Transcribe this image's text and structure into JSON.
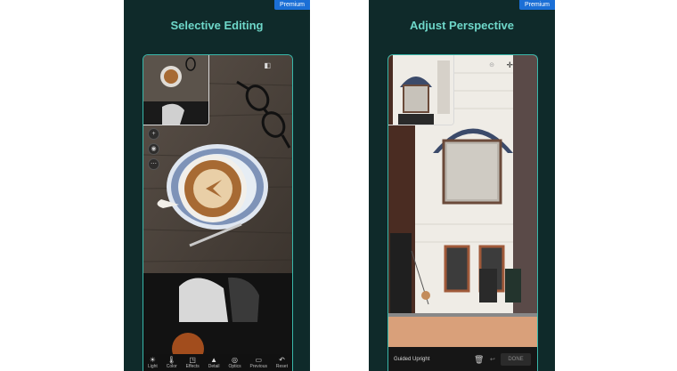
{
  "left_panel": {
    "premium_badge": "Premium",
    "title": "Selective Editing",
    "toolbar": [
      {
        "label": "Light",
        "icon": "sun-icon",
        "glyph": "☀"
      },
      {
        "label": "Color",
        "icon": "thermometer-icon",
        "glyph": "🌡"
      },
      {
        "label": "Effects",
        "icon": "effects-icon",
        "glyph": "◳"
      },
      {
        "label": "Detail",
        "icon": "triangle-icon",
        "glyph": "▲"
      },
      {
        "label": "Optics",
        "icon": "lens-icon",
        "glyph": "◎"
      },
      {
        "label": "Previous",
        "icon": "previous-icon",
        "glyph": "▭"
      },
      {
        "label": "Reset",
        "icon": "reset-icon",
        "glyph": "↶"
      }
    ]
  },
  "right_panel": {
    "premium_badge": "Premium",
    "title": "Adjust Perspective",
    "bottom_bar": {
      "mode_label": "Guided Upright",
      "done_label": "DONE"
    }
  },
  "colors": {
    "panel_bg": "#0f2a2a",
    "title": "#6ed7c9",
    "accent_border": "#39b7aa",
    "badge": "#1b6fd6"
  }
}
